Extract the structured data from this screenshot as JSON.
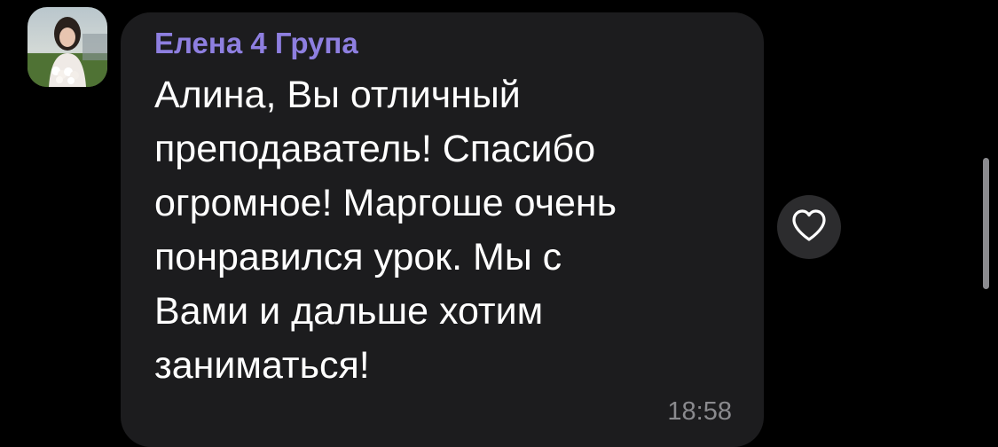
{
  "chat": {
    "message": {
      "sender_name": "Елена 4 Група",
      "text": "Алина, Вы отличный\nпреподаватель! Спасибо\nогромное! Маргоше очень\nпонравился урок. Мы с\nВами и дальше хотим\nзаниматься!",
      "time": "18:58"
    },
    "avatar_icon": "user-photo-avatar",
    "reaction_icon": "heart-outline-icon"
  },
  "colors": {
    "background": "#000000",
    "bubble": "#1c1c1e",
    "sender_name": "#8e7fe0",
    "message_text": "#ffffff",
    "timestamp": "#8a8a8e",
    "reaction_button": "#2c2c2e"
  }
}
